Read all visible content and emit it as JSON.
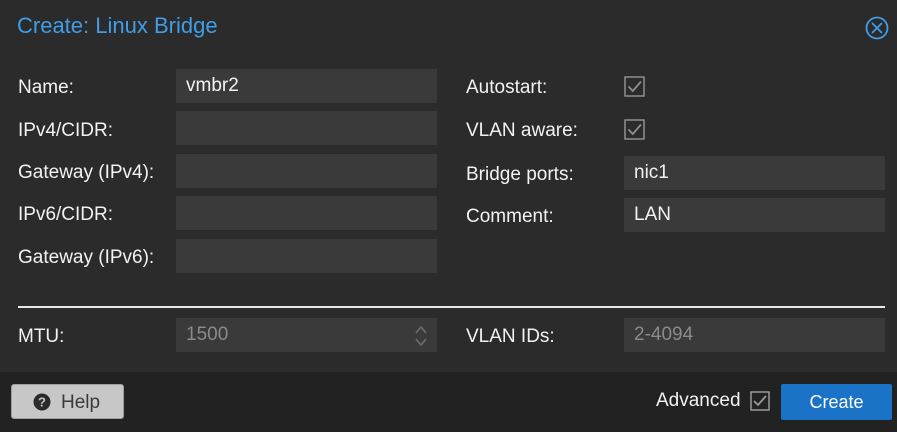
{
  "dialog": {
    "title": "Create: Linux Bridge",
    "close_icon": "close-circle-icon"
  },
  "form": {
    "name": {
      "label": "Name:",
      "value": "vmbr2"
    },
    "ipv4_cidr": {
      "label": "IPv4/CIDR:",
      "value": ""
    },
    "gateway_ipv4": {
      "label": "Gateway (IPv4):",
      "value": ""
    },
    "ipv6_cidr": {
      "label": "IPv6/CIDR:",
      "value": ""
    },
    "gateway_ipv6": {
      "label": "Gateway (IPv6):",
      "value": ""
    },
    "autostart": {
      "label": "Autostart:",
      "checked": true
    },
    "vlan_aware": {
      "label": "VLAN aware:",
      "checked": true
    },
    "bridge_ports": {
      "label": "Bridge ports:",
      "value": "nic1"
    },
    "comment": {
      "label": "Comment:",
      "value": "LAN"
    },
    "mtu": {
      "label": "MTU:",
      "placeholder": "1500"
    },
    "vlan_ids": {
      "label": "VLAN IDs:",
      "placeholder": "2-4094"
    }
  },
  "footer": {
    "help_label": "Help",
    "advanced_label": "Advanced",
    "advanced_checked": true,
    "create_label": "Create"
  },
  "colors": {
    "accent": "#3f9de8",
    "primary_button": "#1a73c7",
    "background": "#2b2b2b",
    "field_background": "#3a3a3a"
  }
}
